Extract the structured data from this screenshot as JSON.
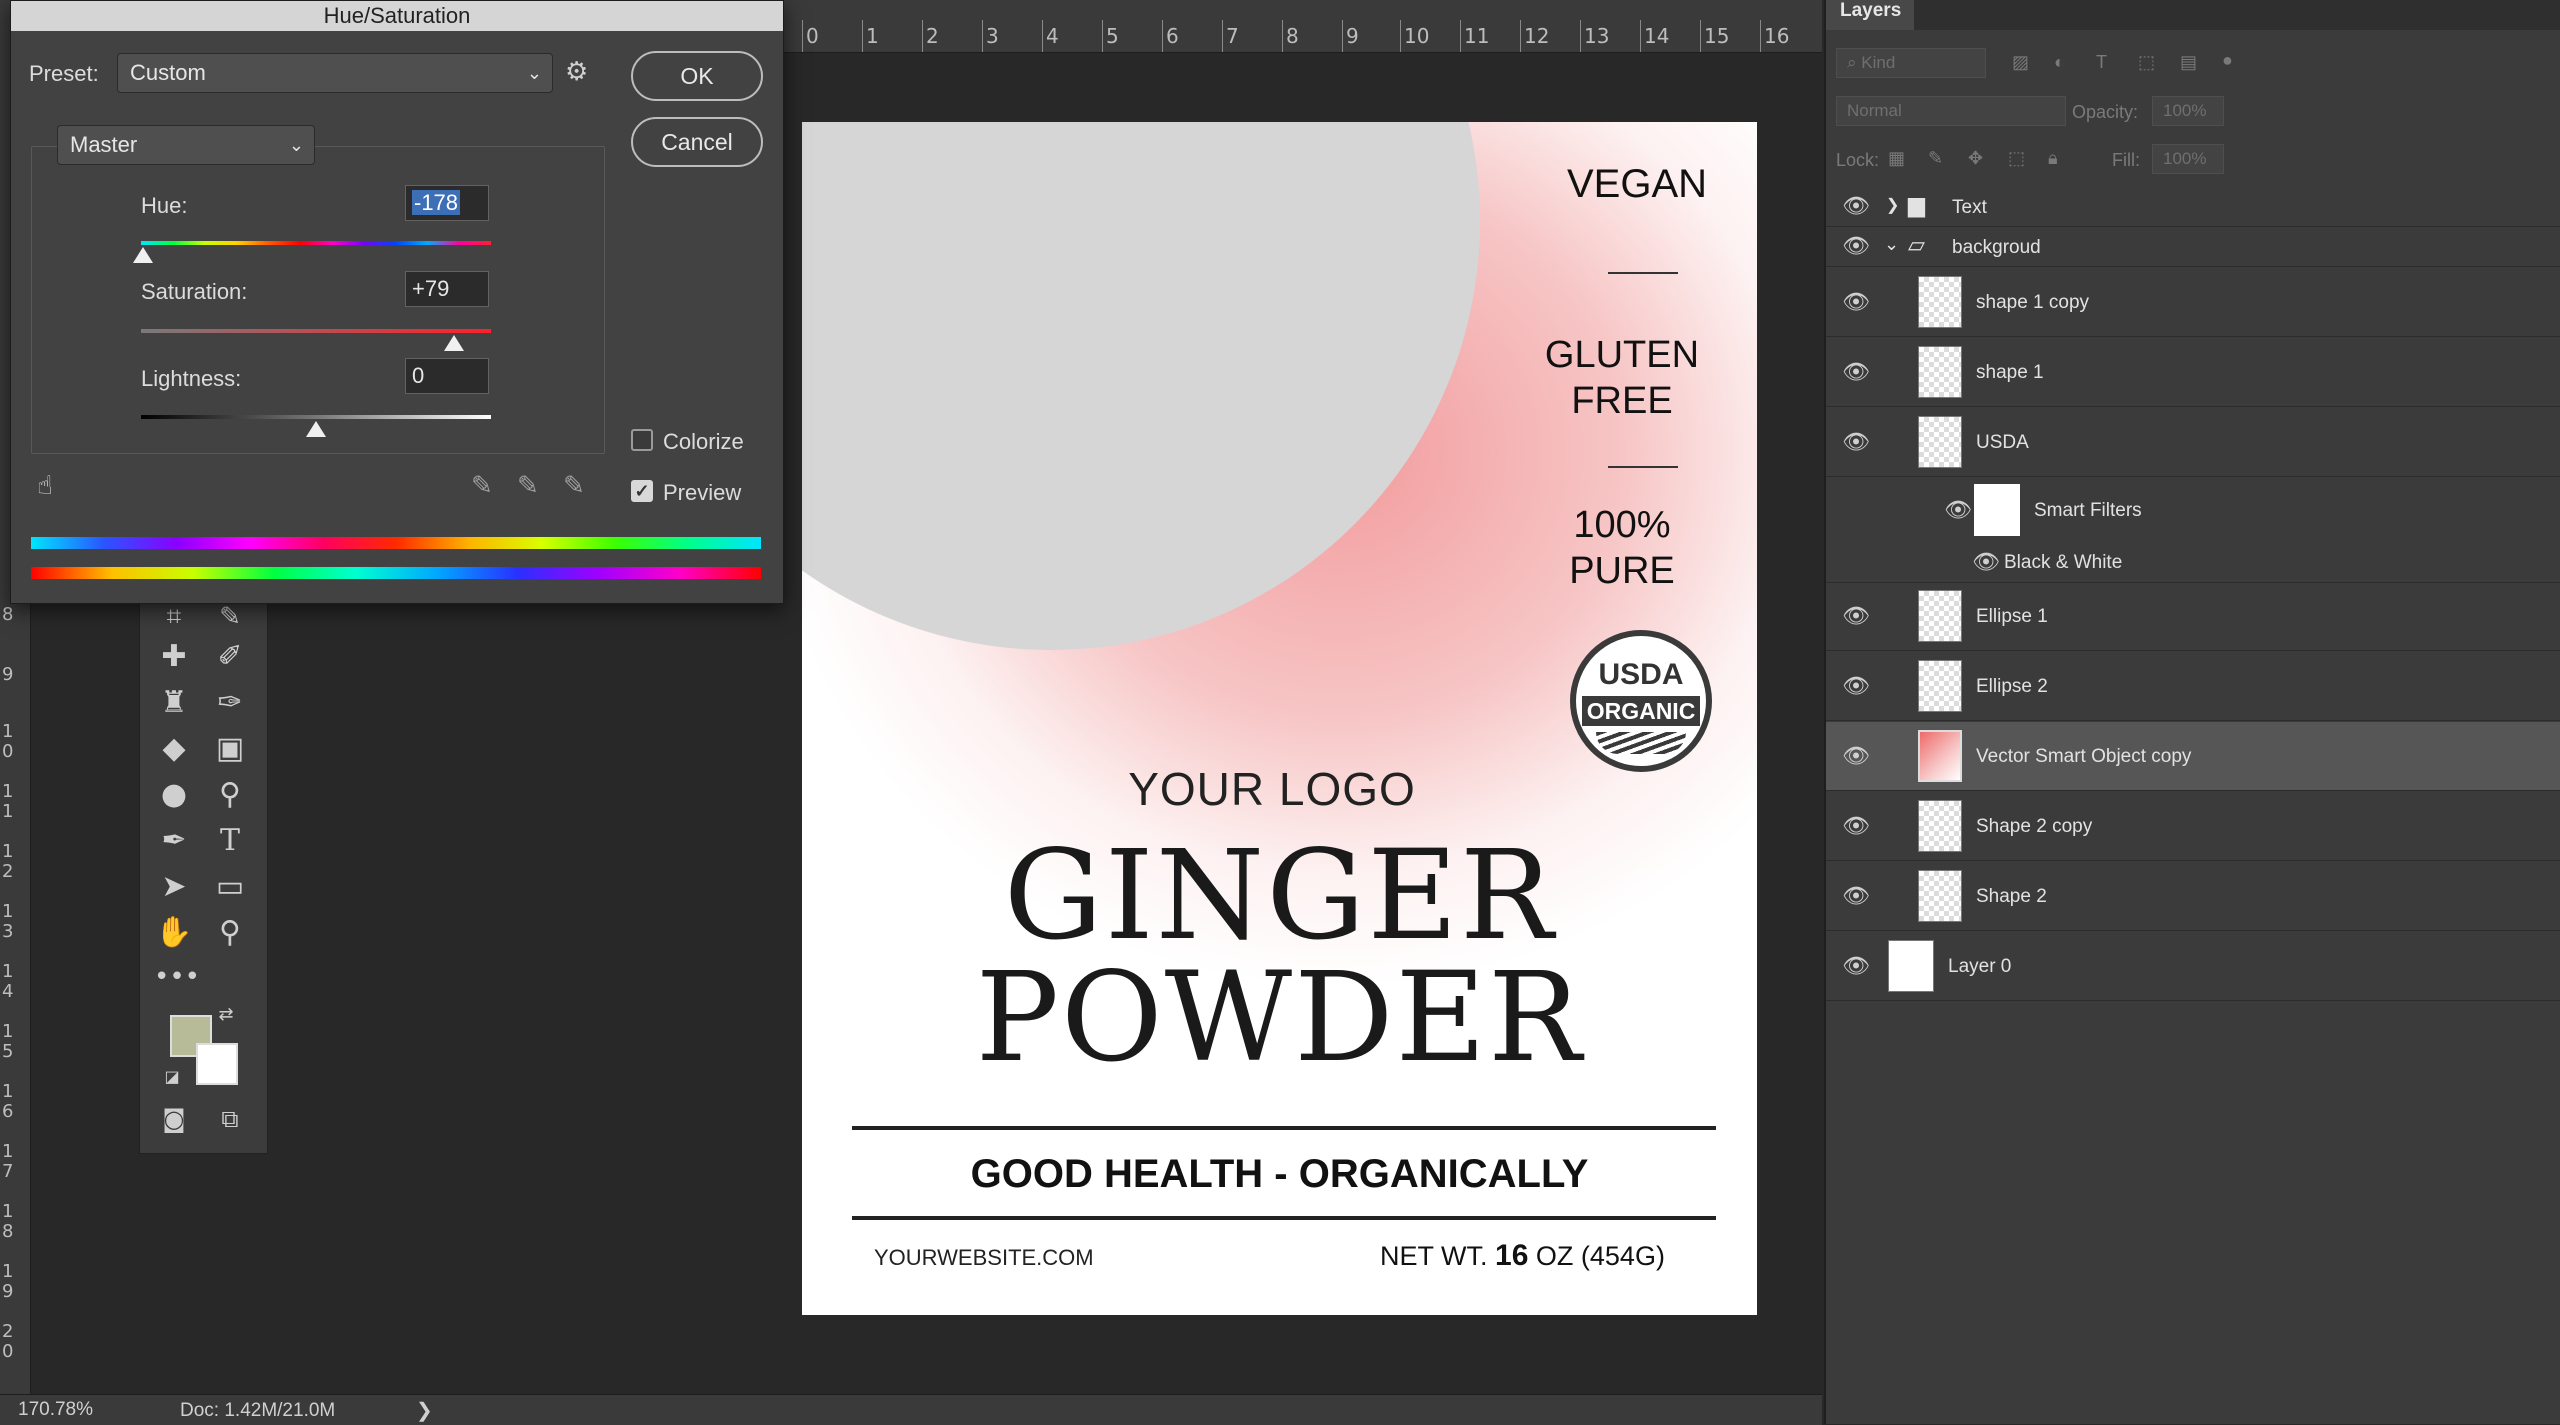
{
  "rulers": {
    "top_ticks": [
      "0",
      "1",
      "2",
      "3",
      "4",
      "5",
      "6",
      "7",
      "8",
      "9",
      "10",
      "11",
      "12",
      "13",
      "14",
      "15",
      "16"
    ],
    "left_ticks": [
      "8",
      "9",
      "1 0",
      "1 1",
      "1 2",
      "1 3",
      "1 4",
      "1 5",
      "1 6",
      "1 7",
      "1 8",
      "1 9",
      "2 0"
    ]
  },
  "status": {
    "zoom": "170.78%",
    "doc": "Doc: 1.42M/21.0M",
    "arrow": "❯"
  },
  "label": {
    "vegan": "VEGAN",
    "gluten_free_1": "GLUTEN",
    "gluten_free_2": "FREE",
    "pure_1": "100%",
    "pure_2": "PURE",
    "usda_1": "USDA",
    "usda_2": "ORGANIC",
    "logo": "YOUR LOGO",
    "title_1": "GINGER",
    "title_2": "POWDER",
    "tagline": "GOOD HEALTH - ORGANICALLY",
    "website": "YOURWEBSITE.COM",
    "net_prefix": "NET WT.",
    "net_qty": "16",
    "net_suffix": "OZ (454G)",
    "colors": {
      "splash": "#ee7a7c",
      "circle": "#d6d6d6"
    }
  },
  "toolbox": {
    "fg_color": "#b8bb98",
    "bg_color": "#ffffff",
    "tools": [
      "crop-icon",
      "eyedropper-icon",
      "healing-brush-icon",
      "brush-icon",
      "clone-stamp-icon",
      "history-brush-icon",
      "eraser-icon",
      "gradient-icon",
      "blur-icon",
      "dodge-icon",
      "pen-icon",
      "type-icon",
      "path-selection-icon",
      "rectangle-icon",
      "hand-icon",
      "zoom-icon",
      "more-tools-icon"
    ]
  },
  "dialog": {
    "title": "Hue/Saturation",
    "preset_label": "Preset:",
    "preset_value": "Custom",
    "ok": "OK",
    "cancel": "Cancel",
    "channel": "Master",
    "hue_label": "Hue:",
    "hue_value": "-178",
    "saturation_label": "Saturation:",
    "saturation_value": "+79",
    "lightness_label": "Lightness:",
    "lightness_value": "0",
    "colorize_label": "Colorize",
    "colorize_checked": false,
    "preview_label": "Preview",
    "preview_checked": true,
    "hue_level": 0.005,
    "saturation_level": 0.895,
    "lightness_level": 0.5
  },
  "layers": {
    "tab": "Layers",
    "filter_placeholder": "Kind",
    "blend_mode": "Normal",
    "opacity_label": "Opacity:",
    "opacity_value": "100%",
    "lock_label": "Lock:",
    "fill_label": "Fill:",
    "fill_value": "100%",
    "rows": [
      {
        "name": "Text",
        "kind": "group-collapsed"
      },
      {
        "name": "backgroud",
        "kind": "group-expanded"
      },
      {
        "name": "shape 1 copy",
        "kind": "shape"
      },
      {
        "name": "shape 1",
        "kind": "shape"
      },
      {
        "name": "USDA",
        "kind": "smart"
      },
      {
        "name": "Smart Filters",
        "kind": "filters"
      },
      {
        "name": "Black & White",
        "kind": "filter"
      },
      {
        "name": "Ellipse 1",
        "kind": "shape"
      },
      {
        "name": "Ellipse 2",
        "kind": "shape"
      },
      {
        "name": "Vector Smart Object copy",
        "kind": "smart-selected"
      },
      {
        "name": "Shape 2 copy",
        "kind": "shape"
      },
      {
        "name": "Shape 2",
        "kind": "shape"
      },
      {
        "name": "Layer 0",
        "kind": "pixel"
      }
    ]
  }
}
